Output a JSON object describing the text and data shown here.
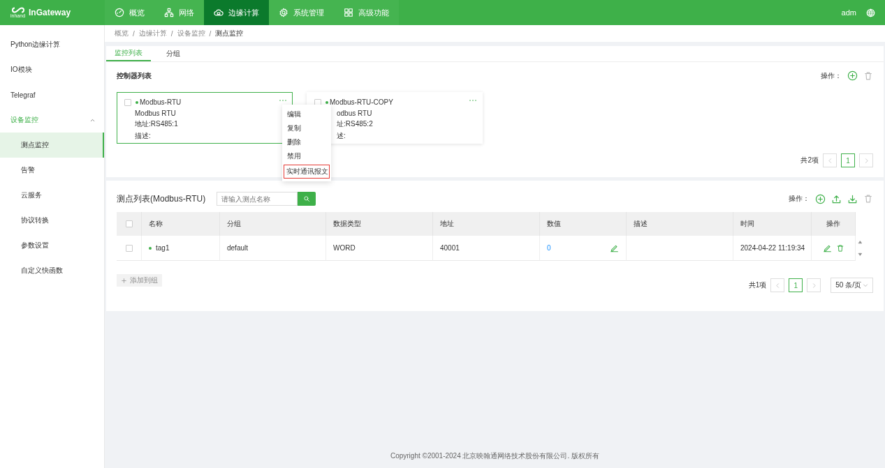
{
  "header": {
    "brand_mark": "inhand",
    "logo_text": "InGateway",
    "nav": [
      {
        "label": "概览",
        "selected": false
      },
      {
        "label": "网络",
        "selected": false
      },
      {
        "label": "边缘计算",
        "selected": true
      },
      {
        "label": "系统管理",
        "selected": false
      },
      {
        "label": "高级功能",
        "selected": false
      }
    ],
    "user": "adm"
  },
  "sidebar": {
    "items": [
      {
        "label": "Python边缘计算",
        "selected": false
      },
      {
        "label": "IO模块",
        "selected": false
      },
      {
        "label": "Telegraf",
        "selected": false
      },
      {
        "label": "设备监控",
        "selected": false,
        "expanded": true,
        "children": [
          {
            "label": "测点监控",
            "selected": true
          },
          {
            "label": "告警",
            "selected": false
          },
          {
            "label": "云服务",
            "selected": false
          },
          {
            "label": "协议转换",
            "selected": false
          },
          {
            "label": "参数设置",
            "selected": false
          },
          {
            "label": "自定义快函数",
            "selected": false
          }
        ]
      }
    ]
  },
  "breadcrumb": {
    "separator": "/",
    "items": [
      "概览",
      "边缘计算",
      "设备监控",
      "测点监控"
    ]
  },
  "tabs": [
    {
      "label": "监控列表",
      "selected": true
    },
    {
      "label": "分组",
      "selected": false
    }
  ],
  "controllers": {
    "title": "控制器列表",
    "actions_label": "操作：",
    "cards": [
      {
        "name": "Modbus-RTU",
        "online": true,
        "checked": false,
        "selected": true,
        "protocol": "Modbus RTU",
        "address": "地址:RS485:1",
        "description": "描述:"
      },
      {
        "name": "Modbus-RTU-COPY",
        "online": true,
        "checked": false,
        "selected": false,
        "protocol": "odbus RTU",
        "address": "址:RS485:2",
        "description": "述:"
      }
    ],
    "pagination": {
      "total": "共2项",
      "pages": [
        {
          "label": "1",
          "selected": true
        }
      ]
    }
  },
  "context_menu": {
    "items": [
      {
        "label": "编辑",
        "highlighted": false
      },
      {
        "label": "复制",
        "highlighted": false
      },
      {
        "label": "删除",
        "highlighted": false
      },
      {
        "label": "禁用",
        "highlighted": false
      },
      {
        "label": "实时通讯报文",
        "highlighted": true
      }
    ]
  },
  "points": {
    "title": "测点列表(Modbus-RTU)",
    "search_placeholder": "请输入测点名称",
    "actions_label": "操作：",
    "select_all_checked": false,
    "columns": [
      "名称",
      "分组",
      "数据类型",
      "地址",
      "数值",
      "描述",
      "时间",
      "操作"
    ],
    "rows": [
      {
        "checked": false,
        "online": true,
        "name": "tag1",
        "group": "default",
        "data_type": "WORD",
        "address": "40001",
        "value": "0",
        "description": "",
        "time": "2024-04-22 11:19:34"
      }
    ],
    "add_to_group": {
      "label": "添加到组",
      "disabled": true
    },
    "pagination": {
      "total": "共1项",
      "pages": [
        {
          "label": "1",
          "selected": true
        }
      ],
      "page_size": "50 条/页"
    }
  },
  "footer": "Copyright ©2001-2024 北京映翰通网络技术股份有限公司. 版权所有"
}
